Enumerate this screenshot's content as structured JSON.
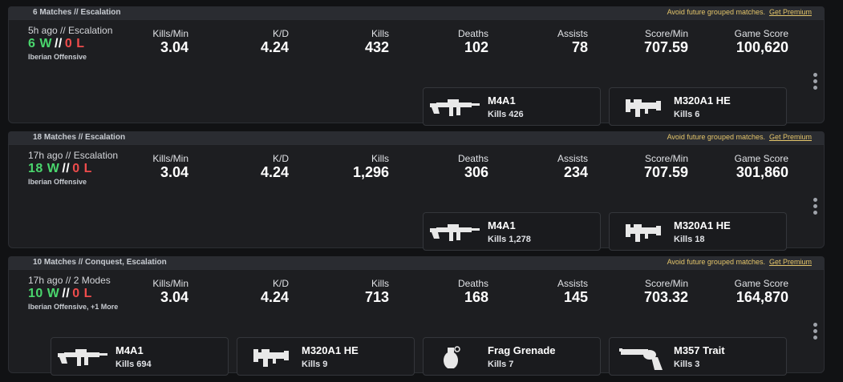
{
  "premium": {
    "text": "Avoid future grouped matches.",
    "link": "Get Premium"
  },
  "stat_labels": {
    "kpm": "Kills/Min",
    "kd": "K/D",
    "kills": "Kills",
    "deaths": "Deaths",
    "assists": "Assists",
    "spm": "Score/Min",
    "score": "Game Score"
  },
  "groups": [
    {
      "header": "6 Matches // Escalation",
      "ago": "5h ago // Escalation",
      "wins": "6 W",
      "sep": "//",
      "losses": "0 L",
      "map": "Iberian Offensive",
      "stats": {
        "kpm": "3.04",
        "kd": "4.24",
        "kills": "432",
        "deaths": "102",
        "assists": "78",
        "spm": "707.59",
        "score": "100,620"
      },
      "weapons": [
        {
          "name": "M4A1",
          "kills": "Kills 426",
          "icon": "rifle-icon"
        },
        {
          "name": "M320A1 HE",
          "kills": "Kills 6",
          "icon": "grenade-launcher-icon"
        }
      ]
    },
    {
      "header": "18 Matches // Escalation",
      "ago": "17h ago // Escalation",
      "wins": "18 W",
      "sep": "//",
      "losses": "0 L",
      "map": "Iberian Offensive",
      "stats": {
        "kpm": "3.04",
        "kd": "4.24",
        "kills": "1,296",
        "deaths": "306",
        "assists": "234",
        "spm": "707.59",
        "score": "301,860"
      },
      "weapons": [
        {
          "name": "M4A1",
          "kills": "Kills 1,278",
          "icon": "rifle-icon"
        },
        {
          "name": "M320A1 HE",
          "kills": "Kills 18",
          "icon": "grenade-launcher-icon"
        }
      ]
    },
    {
      "header": "10 Matches // Conquest, Escalation",
      "ago": "17h ago // 2 Modes",
      "wins": "10 W",
      "sep": "//",
      "losses": "0 L",
      "map": "Iberian Offensive, +1 More",
      "stats": {
        "kpm": "3.04",
        "kd": "4.24",
        "kills": "713",
        "deaths": "168",
        "assists": "145",
        "spm": "703.32",
        "score": "164,870"
      },
      "weapons": [
        {
          "name": "M4A1",
          "kills": "Kills 694",
          "icon": "rifle-icon"
        },
        {
          "name": "M320A1 HE",
          "kills": "Kills 9",
          "icon": "grenade-launcher-icon"
        },
        {
          "name": "Frag Grenade",
          "kills": "Kills 7",
          "icon": "frag-grenade-icon"
        },
        {
          "name": "M357 Trait",
          "kills": "Kills 3",
          "icon": "revolver-icon"
        }
      ]
    }
  ]
}
